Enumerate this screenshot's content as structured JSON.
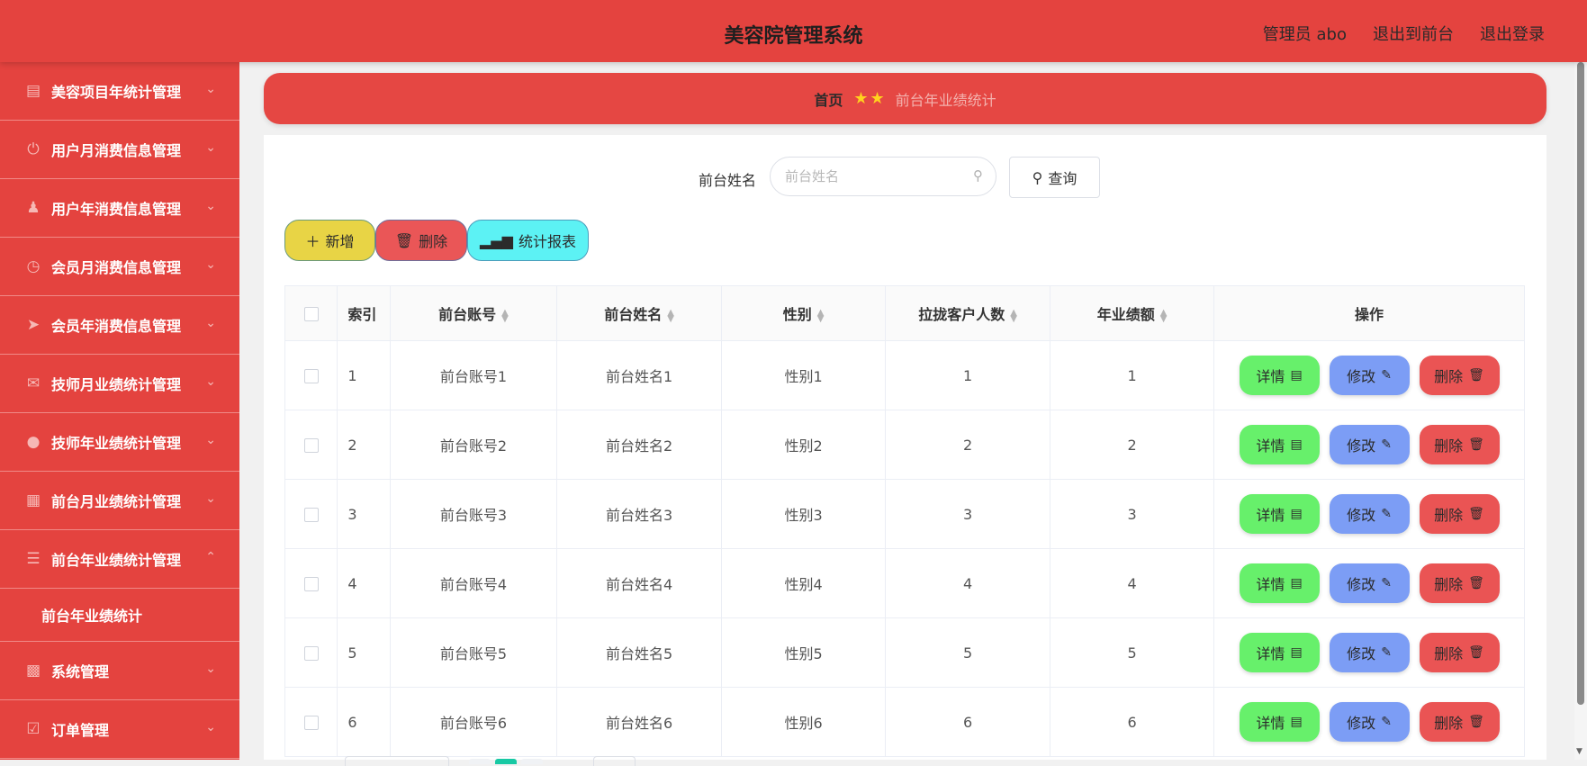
{
  "header": {
    "title": "美容院管理系统",
    "admin": "管理员 abo",
    "back_to_front": "退出到前台",
    "logout": "退出登录"
  },
  "sidebar": {
    "items": [
      {
        "label": "美容项目年统计管理",
        "icon": "monitor-icon"
      },
      {
        "label": "用户月消费信息管理",
        "icon": "power-icon"
      },
      {
        "label": "用户年消费信息管理",
        "icon": "user-stamp-icon"
      },
      {
        "label": "会员月消费信息管理",
        "icon": "clock-icon"
      },
      {
        "label": "会员年消费信息管理",
        "icon": "send-icon"
      },
      {
        "label": "技师月业绩统计管理",
        "icon": "mail-icon"
      },
      {
        "label": "技师年业绩统计管理",
        "icon": "location-icon"
      },
      {
        "label": "前台月业绩统计管理",
        "icon": "chart-icon"
      },
      {
        "label": "前台年业绩统计管理",
        "icon": "sliders-icon",
        "expanded": true
      },
      {
        "label": "系统管理",
        "icon": "clipboard-icon"
      },
      {
        "label": "订单管理",
        "icon": "clipboard-check-icon"
      }
    ],
    "submenu_label": "前台年业绩统计"
  },
  "breadcrumb": {
    "home": "首页",
    "current": "前台年业绩统计"
  },
  "search": {
    "label": "前台姓名",
    "placeholder": "前台姓名",
    "value": "",
    "query_button": "查询"
  },
  "actions": {
    "add": "新增",
    "delete": "删除",
    "stats": "统计报表"
  },
  "table": {
    "columns": [
      "索引",
      "前台账号",
      "前台姓名",
      "性别",
      "拉拢客户人数",
      "年业绩额",
      "操作"
    ],
    "rows": [
      {
        "index": "1",
        "account": "前台账号1",
        "name": "前台姓名1",
        "gender": "性别1",
        "customers": "1",
        "amount": "1"
      },
      {
        "index": "2",
        "account": "前台账号2",
        "name": "前台姓名2",
        "gender": "性别2",
        "customers": "2",
        "amount": "2"
      },
      {
        "index": "3",
        "account": "前台账号3",
        "name": "前台姓名3",
        "gender": "性别3",
        "customers": "3",
        "amount": "3"
      },
      {
        "index": "4",
        "account": "前台账号4",
        "name": "前台姓名4",
        "gender": "性别4",
        "customers": "4",
        "amount": "4"
      },
      {
        "index": "5",
        "account": "前台账号5",
        "name": "前台姓名5",
        "gender": "性别5",
        "customers": "5",
        "amount": "5"
      },
      {
        "index": "6",
        "account": "前台账号6",
        "name": "前台姓名6",
        "gender": "性别6",
        "customers": "6",
        "amount": "6"
      }
    ],
    "op_labels": {
      "detail": "详情",
      "edit": "修改",
      "delete": "删除"
    }
  },
  "colors": {
    "header": "#e4433f",
    "sidebar": "#e4433f",
    "add_button": "#e8d445",
    "delete_button": "#ea5657",
    "stats_button": "#5cf2f4",
    "detail_button": "#67f06b",
    "edit_button": "#7c9df5",
    "row_delete_button": "#ea5454",
    "page_active": "#18c9a4"
  }
}
